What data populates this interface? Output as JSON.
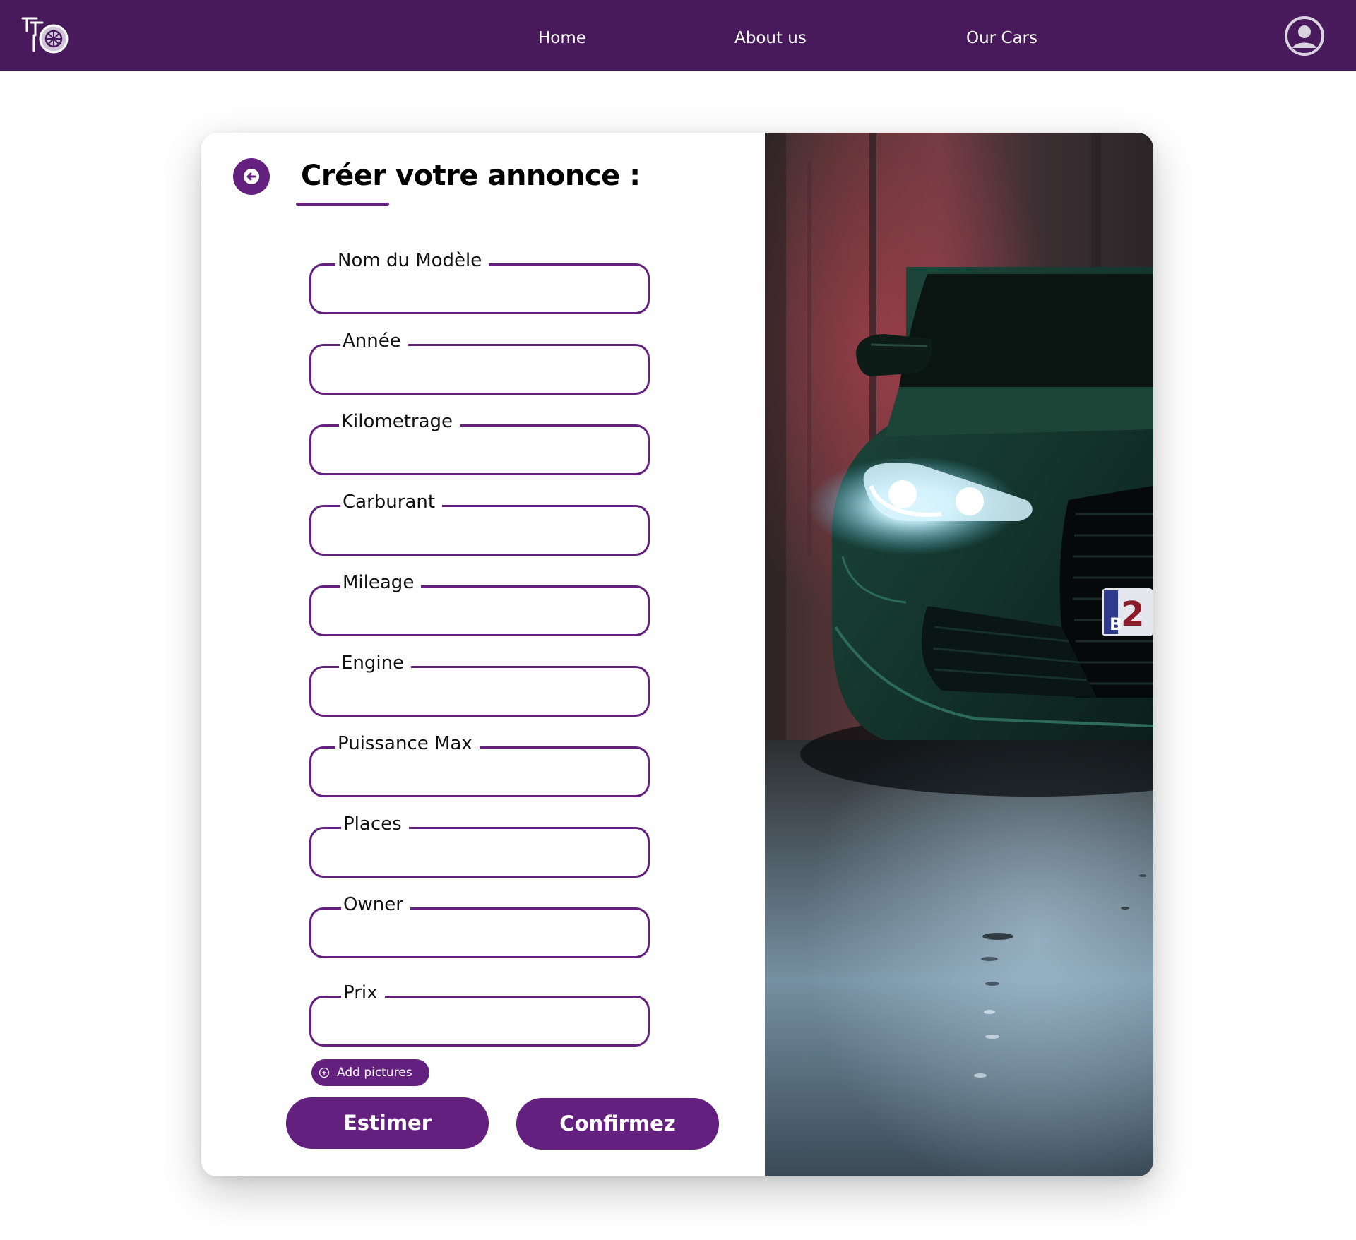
{
  "navbar": {
    "links": [
      {
        "label": "Home"
      },
      {
        "label": "About us"
      },
      {
        "label": "Our Cars"
      }
    ],
    "profile_icon": "user-circle-icon",
    "logo_icon": "wheel-logo-icon"
  },
  "form": {
    "title": "Créer votre annonce :",
    "back_icon": "arrow-left-icon",
    "fields": [
      {
        "label": "Nom du Modèle",
        "value": ""
      },
      {
        "label": "Année",
        "value": ""
      },
      {
        "label": "Kilometrage",
        "value": ""
      },
      {
        "label": "Carburant",
        "value": ""
      },
      {
        "label": "Mileage",
        "value": ""
      },
      {
        "label": "Engine",
        "value": ""
      },
      {
        "label": "Puissance Max",
        "value": ""
      },
      {
        "label": "Places",
        "value": ""
      },
      {
        "label": "Owner",
        "value": ""
      },
      {
        "label": "Prix",
        "value": ""
      }
    ],
    "add_pictures_label": "Add pictures",
    "add_pictures_icon": "plus-circle-icon",
    "estimate_label": "Estimer",
    "confirm_label": "Confirmez"
  },
  "photo": {
    "plate_letter": "B",
    "plate_number": "2"
  },
  "colors": {
    "navbar_bg": "#48195b",
    "accent": "#63207f",
    "card_bg": "#ffffff"
  }
}
